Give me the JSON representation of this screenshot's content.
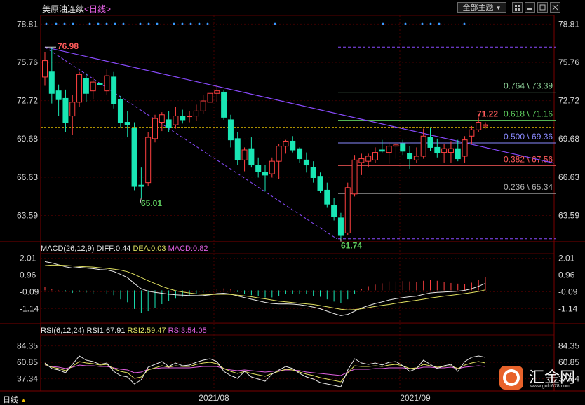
{
  "header": {
    "symbol": "美原油连续",
    "period": "<日线>",
    "theme_button": "全部主题"
  },
  "main_chart": {
    "y_ticks": [
      "78.81",
      "75.76",
      "72.72",
      "69.68",
      "66.63",
      "63.59"
    ],
    "price_labels": {
      "high": "76.98",
      "low1": "65.01",
      "low2": "61.74",
      "last": "71.22"
    },
    "fib_levels": [
      {
        "label": "0.764 \\ 73.39",
        "price": 73.39,
        "color": "#8fd49a"
      },
      {
        "label": "0.618 \\ 71.16",
        "price": 71.16,
        "color": "#5fce5f"
      },
      {
        "label": "0.500 \\ 69.36",
        "price": 69.36,
        "color": "#8a8aff"
      },
      {
        "label": "0.382 \\ 67.56",
        "price": 67.56,
        "color": "#ff5a5a"
      },
      {
        "label": "0.236 \\ 65.34",
        "price": 65.34,
        "color": "#b0b0b0"
      }
    ],
    "fib_top": 76.98,
    "fib_bottom": 61.74,
    "reference_price": 70.6
  },
  "macd": {
    "label": "MACD(26,12,9)",
    "diff": "DIFF:0.44",
    "dea": "DEA:0.03",
    "macd": "MACD:0.82",
    "y_ticks": [
      "2.01",
      "0.96",
      "-0.09",
      "-1.14"
    ]
  },
  "rsi": {
    "label": "RSI(6,12,24)",
    "rsi1": "RSI1:67.91",
    "rsi2": "RSI2:59.47",
    "rsi3": "RSI3:54.05",
    "y_ticks": [
      "84.35",
      "60.85",
      "37.34"
    ]
  },
  "x_axis": {
    "labels": [
      "2021/08",
      "2021/09"
    ]
  },
  "bottom": {
    "period_label": "日线"
  },
  "logo": {
    "text": "汇金网",
    "url": "www.gold678.com"
  },
  "colors": {
    "up": "#ff4040",
    "down": "#19e6b4",
    "ma": "#8a4bff",
    "bg": "#000000",
    "grid": "#3a0000"
  },
  "chart_data": {
    "type": "candlestick",
    "ylim": [
      61.5,
      79.5
    ],
    "candles": [
      {
        "o": 74.6,
        "h": 76.6,
        "l": 73.9,
        "c": 75.9
      },
      {
        "o": 75.0,
        "h": 76.98,
        "l": 72.5,
        "c": 73.3
      },
      {
        "o": 73.5,
        "h": 74.0,
        "l": 71.5,
        "c": 72.8
      },
      {
        "o": 72.9,
        "h": 73.6,
        "l": 70.2,
        "c": 71.0
      },
      {
        "o": 71.5,
        "h": 73.2,
        "l": 70.0,
        "c": 72.6
      },
      {
        "o": 72.6,
        "h": 75.0,
        "l": 72.2,
        "c": 74.8
      },
      {
        "o": 74.5,
        "h": 74.9,
        "l": 72.6,
        "c": 73.3
      },
      {
        "o": 73.5,
        "h": 74.6,
        "l": 72.8,
        "c": 74.2
      },
      {
        "o": 74.1,
        "h": 74.6,
        "l": 73.6,
        "c": 74.0
      },
      {
        "o": 73.5,
        "h": 75.2,
        "l": 73.2,
        "c": 74.7
      },
      {
        "o": 74.6,
        "h": 75.0,
        "l": 72.1,
        "c": 72.5
      },
      {
        "o": 72.8,
        "h": 73.1,
        "l": 70.6,
        "c": 71.0
      },
      {
        "o": 71.0,
        "h": 71.9,
        "l": 69.8,
        "c": 70.8
      },
      {
        "o": 70.5,
        "h": 71.0,
        "l": 65.6,
        "c": 65.9
      },
      {
        "o": 66.0,
        "h": 67.4,
        "l": 65.01,
        "c": 65.9
      },
      {
        "o": 66.2,
        "h": 70.2,
        "l": 65.9,
        "c": 69.8
      },
      {
        "o": 69.7,
        "h": 71.6,
        "l": 69.4,
        "c": 71.3
      },
      {
        "o": 71.0,
        "h": 71.8,
        "l": 70.3,
        "c": 71.6
      },
      {
        "o": 71.2,
        "h": 71.9,
        "l": 70.2,
        "c": 70.6
      },
      {
        "o": 70.8,
        "h": 72.2,
        "l": 70.5,
        "c": 71.5
      },
      {
        "o": 71.5,
        "h": 72.0,
        "l": 70.9,
        "c": 71.2
      },
      {
        "o": 71.5,
        "h": 71.9,
        "l": 71.0,
        "c": 71.5
      },
      {
        "o": 71.5,
        "h": 72.4,
        "l": 71.1,
        "c": 71.9
      },
      {
        "o": 71.9,
        "h": 73.2,
        "l": 71.7,
        "c": 72.7
      },
      {
        "o": 72.6,
        "h": 73.6,
        "l": 72.2,
        "c": 73.3
      },
      {
        "o": 73.3,
        "h": 74.0,
        "l": 72.6,
        "c": 73.5
      },
      {
        "o": 73.4,
        "h": 73.6,
        "l": 71.2,
        "c": 71.4
      },
      {
        "o": 71.2,
        "h": 71.6,
        "l": 69.0,
        "c": 69.6
      },
      {
        "o": 69.7,
        "h": 70.2,
        "l": 67.6,
        "c": 68.0
      },
      {
        "o": 68.0,
        "h": 69.0,
        "l": 67.1,
        "c": 68.8
      },
      {
        "o": 68.9,
        "h": 69.8,
        "l": 67.4,
        "c": 67.6
      },
      {
        "o": 67.6,
        "h": 68.2,
        "l": 66.6,
        "c": 67.1
      },
      {
        "o": 67.0,
        "h": 67.6,
        "l": 65.5,
        "c": 66.8
      },
      {
        "o": 66.9,
        "h": 68.2,
        "l": 66.6,
        "c": 67.9
      },
      {
        "o": 67.9,
        "h": 69.3,
        "l": 66.5,
        "c": 69.1
      },
      {
        "o": 69.1,
        "h": 69.6,
        "l": 68.5,
        "c": 69.5
      },
      {
        "o": 69.5,
        "h": 69.9,
        "l": 68.6,
        "c": 68.8
      },
      {
        "o": 68.9,
        "h": 69.0,
        "l": 67.8,
        "c": 68.1
      },
      {
        "o": 68.0,
        "h": 68.6,
        "l": 67.0,
        "c": 67.6
      },
      {
        "o": 67.4,
        "h": 67.9,
        "l": 66.2,
        "c": 66.6
      },
      {
        "o": 66.7,
        "h": 67.0,
        "l": 65.4,
        "c": 65.6
      },
      {
        "o": 65.6,
        "h": 66.2,
        "l": 64.2,
        "c": 64.5
      },
      {
        "o": 64.4,
        "h": 65.0,
        "l": 63.2,
        "c": 63.5
      },
      {
        "o": 63.4,
        "h": 63.8,
        "l": 61.74,
        "c": 62.0
      },
      {
        "o": 62.2,
        "h": 66.2,
        "l": 62.0,
        "c": 65.8
      },
      {
        "o": 65.3,
        "h": 68.4,
        "l": 65.1,
        "c": 68.0
      },
      {
        "o": 67.8,
        "h": 68.5,
        "l": 66.8,
        "c": 68.1
      },
      {
        "o": 67.9,
        "h": 68.5,
        "l": 67.4,
        "c": 68.3
      },
      {
        "o": 68.0,
        "h": 69.0,
        "l": 67.8,
        "c": 68.6
      },
      {
        "o": 68.8,
        "h": 69.6,
        "l": 68.6,
        "c": 68.7
      },
      {
        "o": 68.6,
        "h": 69.4,
        "l": 67.7,
        "c": 69.1
      },
      {
        "o": 69.1,
        "h": 69.4,
        "l": 68.1,
        "c": 69.2
      },
      {
        "o": 69.3,
        "h": 69.6,
        "l": 68.4,
        "c": 68.7
      },
      {
        "o": 68.5,
        "h": 69.1,
        "l": 67.3,
        "c": 68.1
      },
      {
        "o": 68.0,
        "h": 69.0,
        "l": 67.8,
        "c": 68.3
      },
      {
        "o": 68.3,
        "h": 70.5,
        "l": 68.1,
        "c": 69.9
      },
      {
        "o": 69.8,
        "h": 70.6,
        "l": 68.7,
        "c": 69.0
      },
      {
        "o": 69.0,
        "h": 69.7,
        "l": 68.2,
        "c": 68.6
      },
      {
        "o": 68.6,
        "h": 69.3,
        "l": 67.8,
        "c": 68.9
      },
      {
        "o": 68.6,
        "h": 69.5,
        "l": 67.8,
        "c": 68.9
      },
      {
        "o": 68.9,
        "h": 69.6,
        "l": 67.9,
        "c": 68.1
      },
      {
        "o": 68.3,
        "h": 69.9,
        "l": 67.8,
        "c": 69.6
      },
      {
        "o": 69.9,
        "h": 70.7,
        "l": 69.3,
        "c": 70.4
      },
      {
        "o": 70.4,
        "h": 71.4,
        "l": 70.2,
        "c": 71.0
      },
      {
        "o": 70.7,
        "h": 71.0,
        "l": 70.5,
        "c": 70.8
      }
    ],
    "macd": {
      "ylim": [
        -2.0,
        2.3
      ],
      "diff": [
        1.8,
        1.72,
        1.6,
        1.48,
        1.4,
        1.45,
        1.4,
        1.36,
        1.3,
        1.28,
        1.18,
        1.0,
        0.8,
        0.42,
        0.1,
        -0.05,
        -0.12,
        -0.18,
        -0.24,
        -0.28,
        -0.3,
        -0.32,
        -0.33,
        -0.32,
        -0.28,
        -0.2,
        -0.18,
        -0.23,
        -0.35,
        -0.45,
        -0.55,
        -0.65,
        -0.75,
        -0.82,
        -0.85,
        -0.84,
        -0.86,
        -0.9,
        -0.96,
        -1.05,
        -1.15,
        -1.3,
        -1.45,
        -1.58,
        -1.5,
        -1.3,
        -1.1,
        -0.95,
        -0.82,
        -0.72,
        -0.6,
        -0.52,
        -0.45,
        -0.4,
        -0.36,
        -0.25,
        -0.16,
        -0.12,
        -0.1,
        -0.08,
        -0.05,
        0.0,
        0.1,
        0.25,
        0.44
      ],
      "dea": [
        1.55,
        1.58,
        1.58,
        1.56,
        1.53,
        1.5,
        1.48,
        1.46,
        1.42,
        1.38,
        1.33,
        1.27,
        1.17,
        1.0,
        0.8,
        0.6,
        0.42,
        0.25,
        0.1,
        -0.02,
        -0.1,
        -0.16,
        -0.22,
        -0.25,
        -0.26,
        -0.25,
        -0.24,
        -0.26,
        -0.3,
        -0.34,
        -0.4,
        -0.47,
        -0.53,
        -0.6,
        -0.67,
        -0.72,
        -0.76,
        -0.8,
        -0.84,
        -0.88,
        -0.95,
        -1.02,
        -1.1,
        -1.18,
        -1.22,
        -1.2,
        -1.15,
        -1.08,
        -1.0,
        -0.94,
        -0.88,
        -0.8,
        -0.74,
        -0.68,
        -0.62,
        -0.55,
        -0.48,
        -0.42,
        -0.36,
        -0.31,
        -0.26,
        -0.2,
        -0.14,
        -0.07,
        0.03
      ],
      "hist": [
        0.22,
        0.1,
        0.02,
        -0.08,
        -0.16,
        -0.1,
        -0.14,
        -0.2,
        -0.26,
        -0.2,
        -0.3,
        -0.56,
        -0.74,
        -1.16,
        -1.4,
        -1.3,
        -1.08,
        -0.86,
        -0.68,
        -0.52,
        -0.4,
        -0.32,
        -0.22,
        -0.14,
        -0.04,
        0.1,
        0.12,
        0.06,
        -0.1,
        -0.22,
        -0.3,
        -0.36,
        -0.44,
        -0.44,
        -0.36,
        -0.24,
        -0.2,
        -0.2,
        -0.24,
        -0.34,
        -0.4,
        -0.56,
        -0.7,
        -0.8,
        -0.56,
        -0.2,
        0.1,
        0.26,
        0.36,
        0.44,
        0.56,
        0.56,
        0.58,
        0.56,
        0.52,
        0.6,
        0.64,
        0.6,
        0.52,
        0.46,
        0.42,
        0.4,
        0.48,
        0.64,
        0.82
      ]
    },
    "rsi": {
      "ylim": [
        20,
        100
      ],
      "rsi1": [
        60,
        52,
        50,
        46,
        58,
        70,
        64,
        62,
        58,
        60,
        48,
        42,
        40,
        30,
        36,
        54,
        58,
        62,
        55,
        60,
        56,
        57,
        61,
        64,
        66,
        62,
        48,
        42,
        38,
        48,
        40,
        37,
        34,
        44,
        50,
        55,
        52,
        45,
        40,
        37,
        32,
        30,
        28,
        26,
        50,
        66,
        60,
        58,
        60,
        57,
        61,
        62,
        56,
        48,
        52,
        64,
        58,
        52,
        56,
        58,
        48,
        62,
        68,
        70,
        68
      ],
      "rsi2": [
        58,
        54,
        52,
        49,
        55,
        62,
        60,
        59,
        57,
        58,
        52,
        48,
        46,
        38,
        40,
        50,
        53,
        56,
        54,
        56,
        55,
        55,
        58,
        60,
        61,
        59,
        52,
        48,
        45,
        48,
        45,
        43,
        41,
        45,
        48,
        51,
        50,
        47,
        44,
        42,
        39,
        37,
        35,
        33,
        46,
        56,
        55,
        55,
        56,
        55,
        57,
        58,
        56,
        52,
        53,
        58,
        56,
        54,
        55,
        56,
        52,
        57,
        60,
        62,
        60
      ],
      "rsi3": [
        56,
        55,
        54,
        52,
        54,
        57,
        56,
        56,
        55,
        55,
        53,
        51,
        50,
        46,
        47,
        51,
        52,
        53,
        53,
        53,
        53,
        53,
        54,
        55,
        55,
        55,
        52,
        50,
        49,
        50,
        49,
        48,
        47,
        48,
        49,
        50,
        50,
        49,
        47,
        46,
        45,
        44,
        43,
        42,
        47,
        51,
        51,
        51,
        52,
        52,
        53,
        53,
        53,
        52,
        52,
        54,
        54,
        53,
        53,
        54,
        52,
        54,
        55,
        56,
        55
      ]
    }
  }
}
